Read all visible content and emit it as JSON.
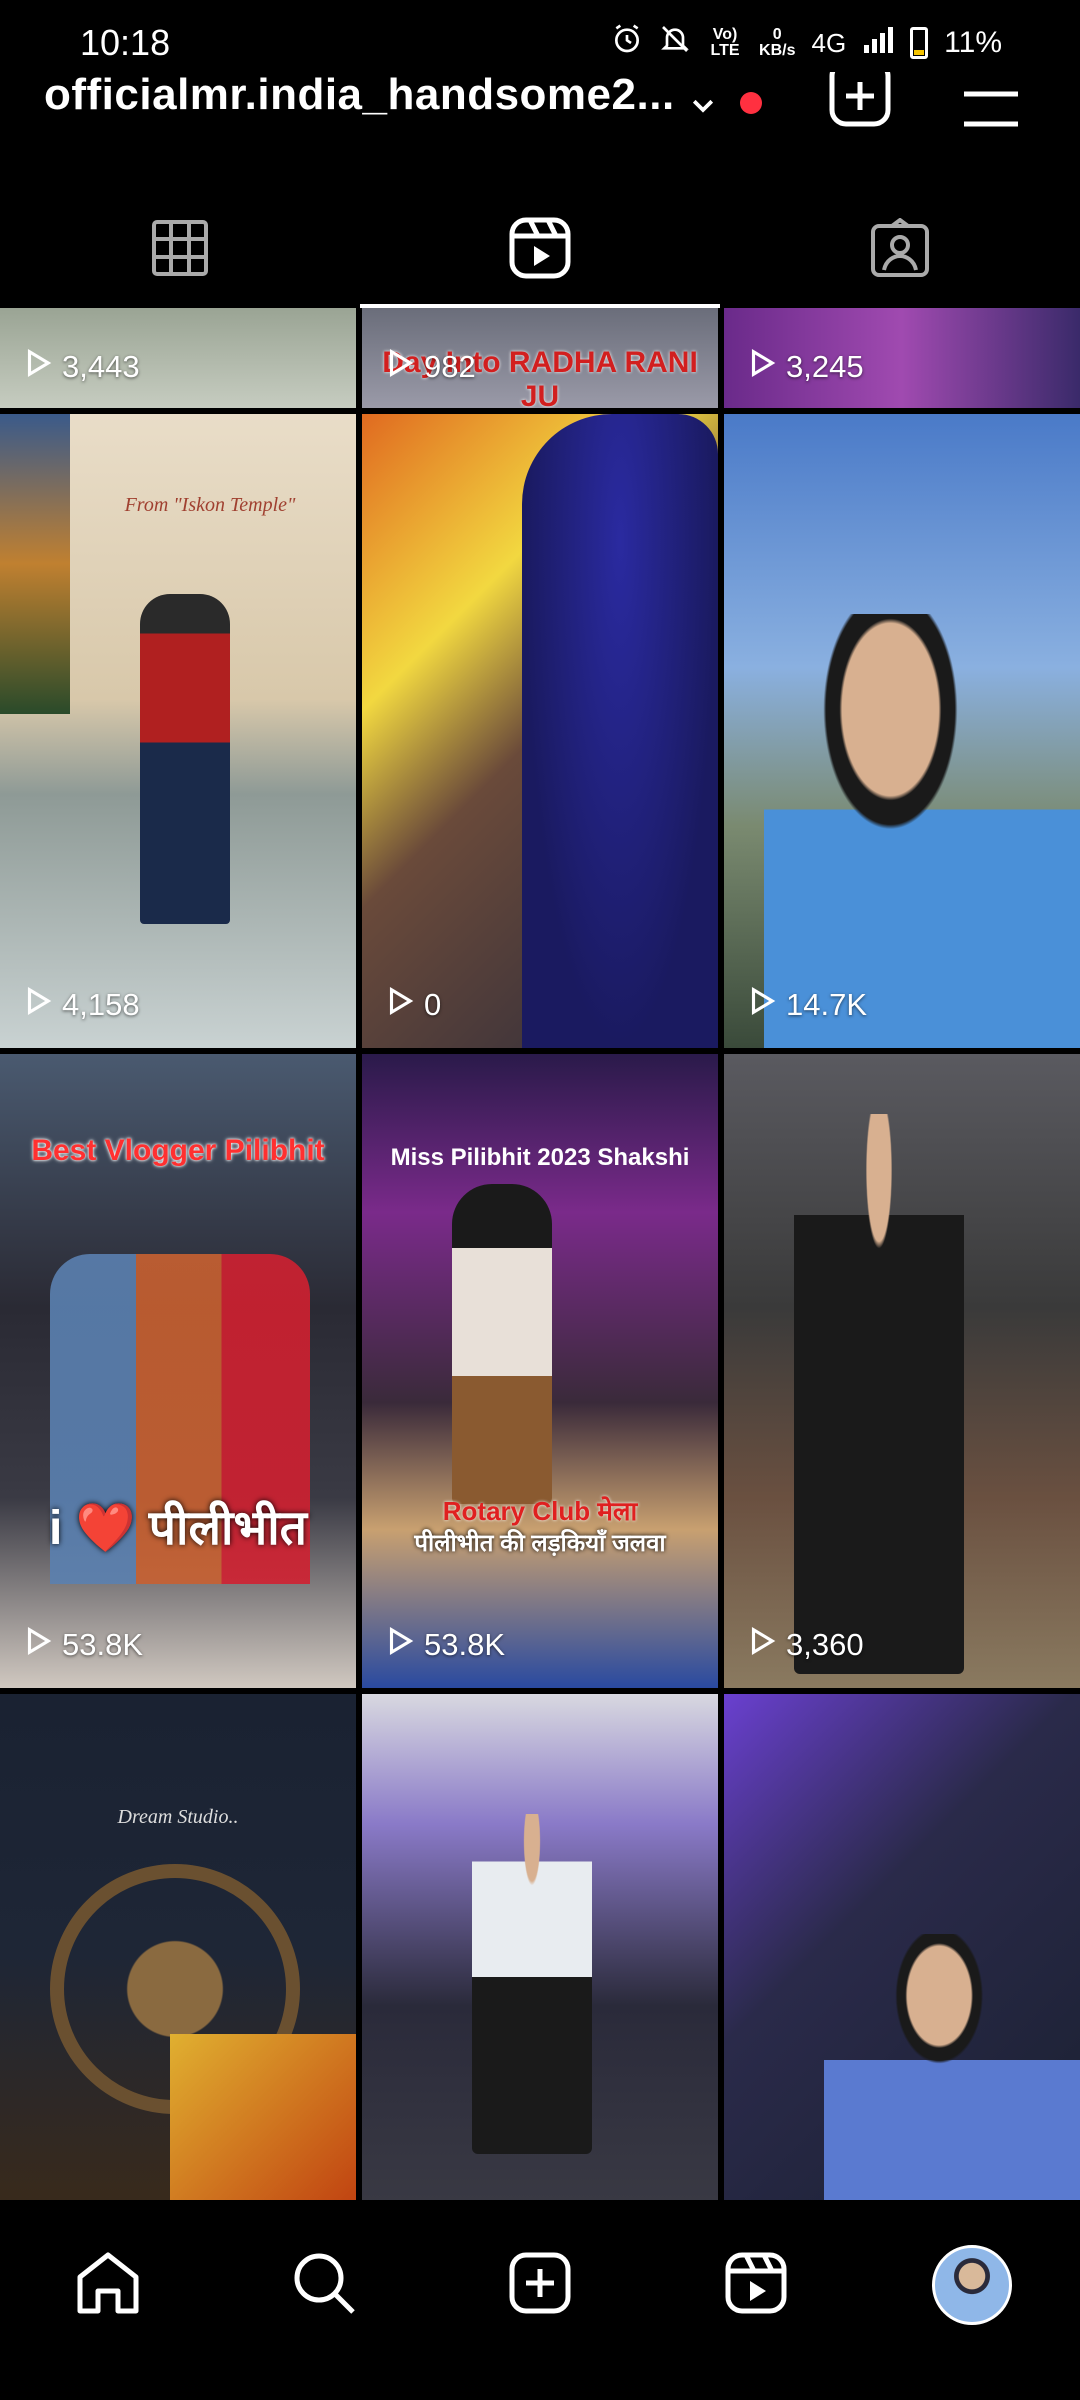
{
  "status_bar": {
    "time": "10:18",
    "network_speed_value": "0",
    "network_speed_unit": "KB/s",
    "volte": "Vo) LTE",
    "signal": "4G",
    "battery": "11%"
  },
  "header": {
    "username": "officialmr.india_handsome2..."
  },
  "tabs": [
    {
      "name": "posts-grid",
      "icon": "grid-icon"
    },
    {
      "name": "reels",
      "icon": "reels-icon",
      "active": true
    },
    {
      "name": "tagged",
      "icon": "tagged-person-icon"
    }
  ],
  "reels": [
    {
      "views": "3,443",
      "caption": ""
    },
    {
      "views": "982",
      "caption": "Day Into RADHA RANI JU"
    },
    {
      "views": "3,245",
      "caption": ""
    },
    {
      "views": "4,158",
      "caption": "From \"Iskon Temple\""
    },
    {
      "views": "0",
      "caption": ""
    },
    {
      "views": "14.7K",
      "caption": ""
    },
    {
      "views": "53.8K",
      "caption": "Best Vlogger Pilibhit",
      "caption2": "i ❤️ पीलीभीत"
    },
    {
      "views": "53.8K",
      "caption": "Miss Pilibhit 2023  Shakshi",
      "caption2": "Rotary Club मेला",
      "caption3": "पीलीभीत की लड़कियाँ जलवा"
    },
    {
      "views": "3,360",
      "caption": ""
    },
    {
      "views": "",
      "caption": "Dream Studio.."
    },
    {
      "views": "",
      "caption": ""
    },
    {
      "views": "",
      "caption": ""
    }
  ],
  "bottom_nav": [
    "home-icon",
    "search-icon",
    "create-icon",
    "reels-icon",
    "profile-avatar"
  ]
}
